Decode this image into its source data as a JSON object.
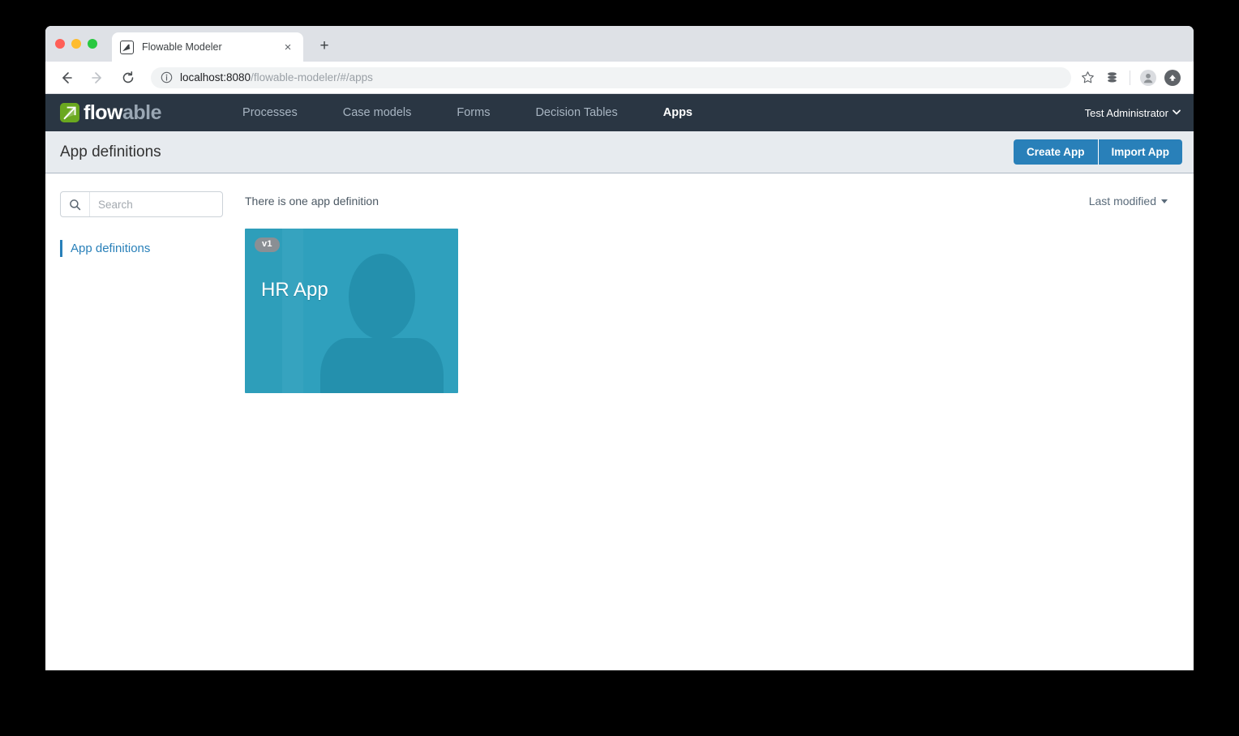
{
  "browser": {
    "tab": {
      "title": "Flowable Modeler",
      "favicon": "flowable-favicon-icon",
      "close_label": "×"
    },
    "new_tab_label": "+",
    "back_label": "←",
    "forward_label": "→",
    "reload_label": "⟳",
    "address": {
      "host": "localhost:8080",
      "path": "/flowable-modeler/#/apps",
      "info_icon": "info-circle-icon"
    },
    "toolbar_icons": [
      "bookmark-star-icon",
      "extensions-stack-icon",
      "profile-avatar-icon",
      "update-arrow-icon"
    ]
  },
  "app": {
    "brand": {
      "name_first": "flow",
      "name_second": "able",
      "mark": "flowable-logo-icon"
    },
    "nav": {
      "items": [
        {
          "label": "Processes",
          "active": false
        },
        {
          "label": "Case models",
          "active": false
        },
        {
          "label": "Forms",
          "active": false
        },
        {
          "label": "Decision Tables",
          "active": false
        },
        {
          "label": "Apps",
          "active": true
        }
      ],
      "user": {
        "name": "Test Administrator",
        "chevron": "⌄"
      }
    },
    "subheader": {
      "title": "App definitions",
      "create_button": "Create App",
      "import_button": "Import App"
    },
    "sidebar": {
      "search": {
        "placeholder": "Search",
        "value": "",
        "icon": "search-icon"
      },
      "items": [
        {
          "label": "App definitions",
          "active": true
        }
      ]
    },
    "main": {
      "count_text": "There is one app definition",
      "sort": {
        "label": "Last modified",
        "caret": "caret-down-icon"
      },
      "cards": [
        {
          "title": "HR App",
          "version_badge": "v1",
          "icon": "person-silhouette-icon",
          "background_color": "#2fa0bd"
        }
      ]
    },
    "colors": {
      "navbar": "#2a3643",
      "accent_blue": "#2980b9",
      "brand_green": "#6aa81f",
      "subheader_bg": "#e7ebef",
      "card_teal": "#2fa0bd"
    }
  }
}
